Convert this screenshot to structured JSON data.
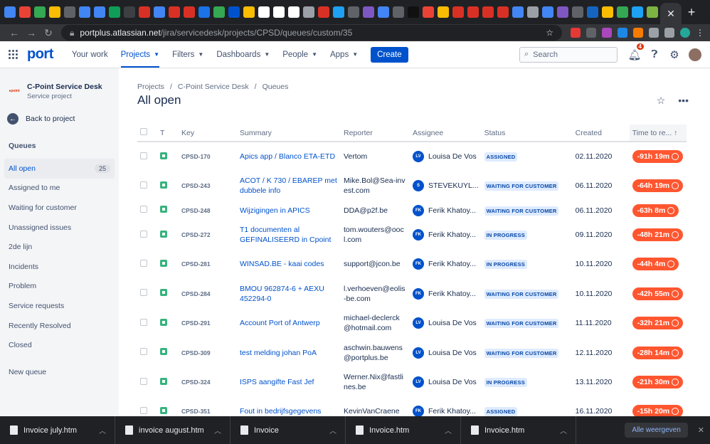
{
  "browser": {
    "url_host": "portplus.atlassian.net",
    "url_path": "/jira/servicedesk/projects/CPSD/queues/custom/35",
    "close_tab": "✕",
    "new_tab": "+"
  },
  "topnav": {
    "logo": "port",
    "your_work": "Your work",
    "projects": "Projects",
    "filters": "Filters",
    "dashboards": "Dashboards",
    "people": "People",
    "apps": "Apps",
    "create": "Create",
    "search_placeholder": "Search",
    "notifications_count": "4"
  },
  "sidebar": {
    "project_name": "C-Point Service Desk",
    "project_type": "Service project",
    "back": "Back to project",
    "queues_heading": "Queues",
    "items": [
      {
        "label": "All open",
        "count": "25"
      },
      {
        "label": "Assigned to me"
      },
      {
        "label": "Waiting for customer"
      },
      {
        "label": "Unassigned issues"
      },
      {
        "label": "2de lijn"
      },
      {
        "label": "Incidents"
      },
      {
        "label": "Problem"
      },
      {
        "label": "Service requests"
      },
      {
        "label": "Recently Resolved"
      },
      {
        "label": "Closed"
      }
    ],
    "new_queue": "New queue"
  },
  "page": {
    "crumb_projects": "Projects",
    "crumb_project": "C-Point Service Desk",
    "crumb_queues": "Queues",
    "title": "All open"
  },
  "table": {
    "headers": {
      "type": "T",
      "key": "Key",
      "summary": "Summary",
      "reporter": "Reporter",
      "assignee": "Assignee",
      "status": "Status",
      "created": "Created",
      "time": "Time to re..."
    },
    "rows": [
      {
        "key": "CPSD-170",
        "summary": "Apics app / Blanco ETA-ETD",
        "reporter": "Vertom",
        "assignee_initials": "LV",
        "assignee": "Louisa De Vos",
        "status": "ASSIGNED",
        "created": "02.11.2020",
        "sla": "-91h 19m"
      },
      {
        "key": "CPSD-243",
        "summary": "ACOT / K 730 / EBAREP met dubbele info",
        "reporter": "Mike.Bol@Sea-invest.com",
        "assignee_initials": "S",
        "assignee": "STEVEKUYL...",
        "status": "WAITING FOR CUSTOMER",
        "created": "06.11.2020",
        "sla": "-64h 19m"
      },
      {
        "key": "CPSD-248",
        "summary": "Wijzigingen in APICS",
        "reporter": "DDA@p2f.be",
        "assignee_initials": "FK",
        "assignee": "Ferik Khatoy...",
        "status": "WAITING FOR CUSTOMER",
        "created": "06.11.2020",
        "sla": "-63h 8m"
      },
      {
        "key": "CPSD-272",
        "summary": "T1 documenten al GEFINALISEERD in Cpoint",
        "reporter": "tom.wouters@oocl.com",
        "assignee_initials": "FK",
        "assignee": "Ferik Khatoy...",
        "status": "IN PROGRESS",
        "created": "09.11.2020",
        "sla": "-48h 21m"
      },
      {
        "key": "CPSD-281",
        "summary": "WINSAD.BE - kaai codes",
        "reporter": "support@jcon.be",
        "assignee_initials": "FK",
        "assignee": "Ferik Khatoy...",
        "status": "IN PROGRESS",
        "created": "10.11.2020",
        "sla": "-44h 4m"
      },
      {
        "key": "CPSD-284",
        "summary": "BMOU 962874-6 + AEXU 452294-0",
        "reporter": "l.verhoeven@eolis-be.com",
        "assignee_initials": "FK",
        "assignee": "Ferik Khatoy...",
        "status": "WAITING FOR CUSTOMER",
        "created": "10.11.2020",
        "sla": "-42h 55m"
      },
      {
        "key": "CPSD-291",
        "summary": "Account Port of Antwerp",
        "reporter": "michael-declerck@hotmail.com",
        "assignee_initials": "LV",
        "assignee": "Louisa De Vos",
        "status": "WAITING FOR CUSTOMER",
        "created": "11.11.2020",
        "sla": "-32h 21m"
      },
      {
        "key": "CPSD-309",
        "summary": "test melding johan PoA",
        "reporter": "aschwin.bauwens@portplus.be",
        "assignee_initials": "LV",
        "assignee": "Louisa De Vos",
        "status": "WAITING FOR CUSTOMER",
        "created": "12.11.2020",
        "sla": "-28h 14m"
      },
      {
        "key": "CPSD-324",
        "summary": "ISPS aangifte Fast Jef",
        "reporter": "Werner.Nix@fastlines.be",
        "assignee_initials": "LV",
        "assignee": "Louisa De Vos",
        "status": "IN PROGRESS",
        "created": "13.11.2020",
        "sla": "-21h 30m"
      },
      {
        "key": "CPSD-351",
        "summary": "Fout in bedrijfsgegevens",
        "reporter": "KevinVanCraene",
        "assignee_initials": "FK",
        "assignee": "Ferik Khatoy...",
        "status": "ASSIGNED",
        "created": "16.11.2020",
        "sla": "-15h 20m"
      }
    ]
  },
  "downloads": {
    "items": [
      "Invoice july.htm",
      "invoice august.htm",
      "Invoice",
      "Invoice.htm",
      "Invoice.htm"
    ],
    "show_all": "Alle weergeven"
  },
  "colors": {
    "accent": "#0052cc",
    "sla_red": "#ff5630",
    "sidebar_bg": "#f4f5f7"
  }
}
